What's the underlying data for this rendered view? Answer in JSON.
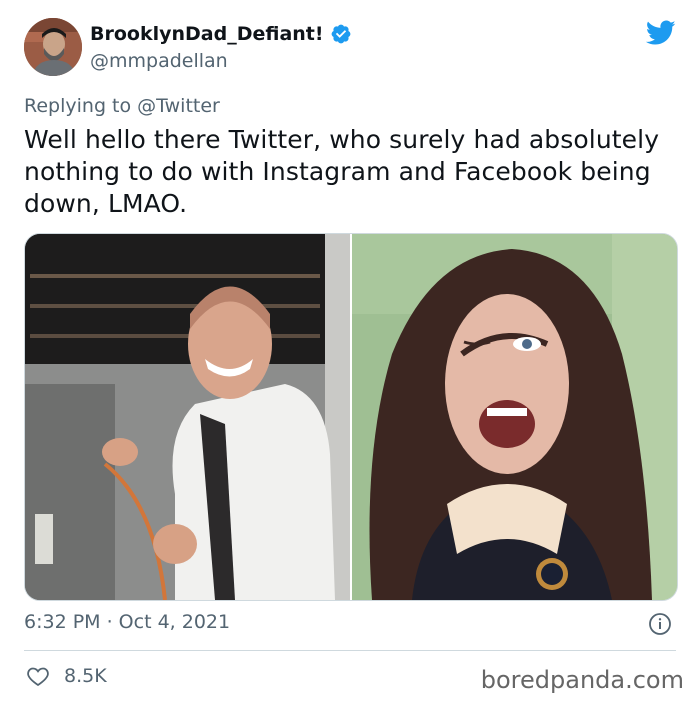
{
  "user": {
    "display_name": "BrooklynDad_Defiant!",
    "handle": "@mmpadellan"
  },
  "reply": {
    "prefix": "Replying to",
    "target": "@Twitter"
  },
  "tweet": {
    "text": "Well hello there Twitter, who surely had absolutely nothing to do with Instagram and Facebook being down, LMAO.",
    "timestamp": "6:32 PM · Oct 4, 2021",
    "likes": "8.5K"
  },
  "watermark": "boredpanda.com",
  "colors": {
    "accent": "#1d9bf0",
    "secondary_text": "#536471"
  },
  "icons": [
    "twitter-bird-icon",
    "verified-badge-icon",
    "info-icon",
    "heart-icon"
  ]
}
